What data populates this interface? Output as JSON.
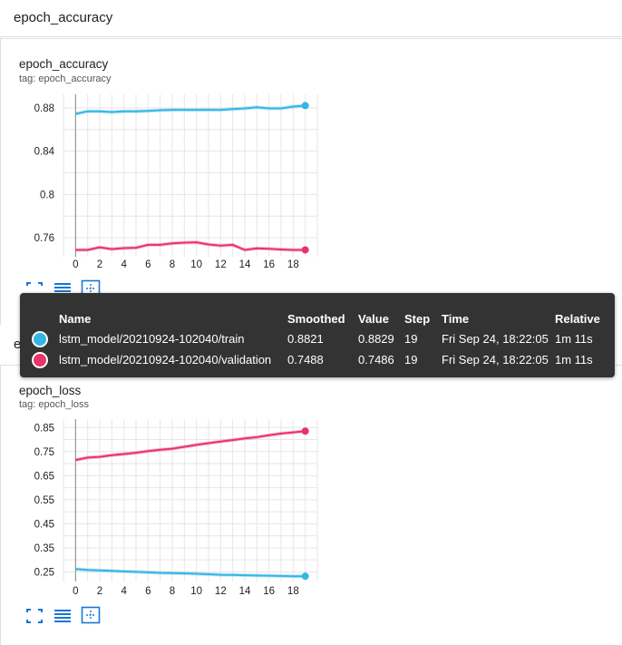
{
  "section": {
    "title": "epoch_accuracy"
  },
  "cards": [
    {
      "title": "epoch_accuracy",
      "tag": "tag: epoch_accuracy"
    },
    {
      "title": "epoch_loss",
      "tag": "tag: epoch_loss"
    }
  ],
  "loss_section_title": "epoch_loss",
  "colors": {
    "train": "#33b5e5",
    "validation": "#e8336b",
    "tooltip_bg": "#333333"
  },
  "icons": [
    "fit-to-data-icon",
    "data-table-icon",
    "toggle-y-axis-icon"
  ],
  "tooltip": {
    "headers": {
      "name": "Name",
      "smoothed": "Smoothed",
      "value": "Value",
      "step": "Step",
      "time": "Time",
      "relative": "Relative"
    },
    "rows": [
      {
        "name": "lstm_model/20210924-102040/train",
        "smoothed": "0.8821",
        "value": "0.8829",
        "step": "19",
        "time": "Fri Sep 24, 18:22:05",
        "relative": "1m 11s"
      },
      {
        "name": "lstm_model/20210924-102040/validation",
        "smoothed": "0.7488",
        "value": "0.7486",
        "step": "19",
        "time": "Fri Sep 24, 18:22:05",
        "relative": "1m 11s"
      }
    ]
  },
  "chart_data": [
    {
      "type": "line",
      "title": "epoch_accuracy",
      "xlim": [
        -1,
        20
      ],
      "ylim": [
        0.7425,
        0.8925
      ],
      "xticks": [
        0,
        2,
        4,
        6,
        8,
        10,
        12,
        14,
        16,
        18
      ],
      "yticks": [
        0.76,
        0.8,
        0.84,
        0.88
      ],
      "ytick_labels": [
        "0.76",
        "0.8",
        "0.84",
        "0.88"
      ],
      "x": [
        0,
        1,
        2,
        3,
        4,
        5,
        6,
        7,
        8,
        9,
        10,
        11,
        12,
        13,
        14,
        15,
        16,
        17,
        18,
        19
      ],
      "series": [
        {
          "name": "train",
          "values": [
            0.8745,
            0.8768,
            0.8768,
            0.8762,
            0.8768,
            0.8768,
            0.8772,
            0.8778,
            0.8782,
            0.8782,
            0.8782,
            0.8782,
            0.8782,
            0.8788,
            0.8795,
            0.8805,
            0.8795,
            0.8795,
            0.8812,
            0.8821
          ]
        },
        {
          "name": "validation",
          "values": [
            0.7488,
            0.7488,
            0.7512,
            0.7495,
            0.7505,
            0.7508,
            0.7535,
            0.7535,
            0.7548,
            0.7555,
            0.7558,
            0.7538,
            0.7528,
            0.7535,
            0.7488,
            0.7502,
            0.7498,
            0.7492,
            0.7488,
            0.7488
          ]
        }
      ],
      "grid": true
    },
    {
      "type": "line",
      "title": "epoch_loss",
      "xlim": [
        -1,
        20
      ],
      "ylim": [
        0.21,
        0.885
      ],
      "xticks": [
        0,
        2,
        4,
        6,
        8,
        10,
        12,
        14,
        16,
        18
      ],
      "yticks": [
        0.25,
        0.35,
        0.45,
        0.55,
        0.65,
        0.75,
        0.85
      ],
      "ytick_labels": [
        "0.25",
        "0.35",
        "0.45",
        "0.55",
        "0.65",
        "0.75",
        "0.85"
      ],
      "x": [
        0,
        1,
        2,
        3,
        4,
        5,
        6,
        7,
        8,
        9,
        10,
        11,
        12,
        13,
        14,
        15,
        16,
        17,
        18,
        19
      ],
      "series": [
        {
          "name": "train",
          "values": [
            0.262,
            0.258,
            0.256,
            0.254,
            0.252,
            0.25,
            0.248,
            0.246,
            0.245,
            0.244,
            0.242,
            0.24,
            0.238,
            0.237,
            0.236,
            0.235,
            0.234,
            0.233,
            0.232,
            0.232
          ]
        },
        {
          "name": "validation",
          "values": [
            0.715,
            0.725,
            0.728,
            0.735,
            0.74,
            0.745,
            0.752,
            0.758,
            0.762,
            0.77,
            0.778,
            0.785,
            0.792,
            0.798,
            0.805,
            0.81,
            0.818,
            0.825,
            0.83,
            0.835
          ]
        }
      ],
      "grid": true
    }
  ]
}
